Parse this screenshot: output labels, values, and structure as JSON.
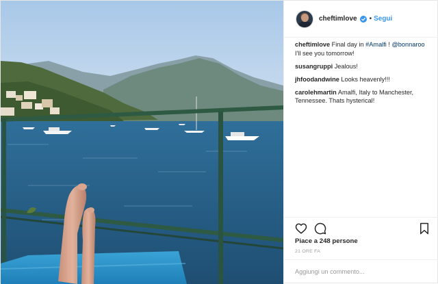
{
  "post": {
    "photo_alt": "",
    "author": {
      "username": "cheftimlove",
      "verified": true,
      "follow_label": "Segui"
    },
    "caption": {
      "user": "cheftimlove",
      "text_before": "Final day in ",
      "hashtag": "#Amalfi",
      "text_middle": " ! ",
      "mention": "@bonnaroo",
      "text_after": "I'll see you tomorrow!"
    },
    "comments": [
      {
        "user": "susangruppi",
        "text": "Jealous!"
      },
      {
        "user": "jhfoodandwine",
        "text": "Looks heavenly!!!"
      },
      {
        "user": "carolehmartin",
        "text": "Amalfi, Italy to Manchester, Tennessee. Thats hysterical!"
      }
    ],
    "likes_label": "Piace a 248 persone",
    "timestamp": "21 ORE FA",
    "comment_placeholder": "Aggiungi un commento...",
    "icons": [
      "heart-icon",
      "comment-icon",
      "bookmark-icon",
      "verified-badge-icon"
    ],
    "colors": {
      "link": "#3897f0",
      "text": "#262626",
      "muted": "#999999",
      "mention": "#003569"
    }
  }
}
